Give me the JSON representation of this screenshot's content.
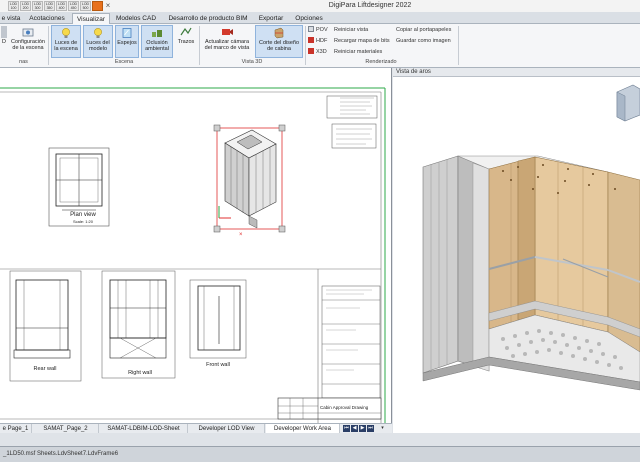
{
  "window": {
    "title": "DigiPara Liftdesigner 2022",
    "close_glyph": "×"
  },
  "qat": [
    "LOD 100",
    "LOD 200",
    "LOD 300",
    "LOD 350",
    "LOD 400",
    "LOD 450",
    "LOD 500"
  ],
  "tabs": [
    {
      "label": "e vista"
    },
    {
      "label": "Acotaciones"
    },
    {
      "label": "Visualizar"
    },
    {
      "label": "Modelos CAD"
    },
    {
      "label": "Desarrollo de producto BIM"
    },
    {
      "label": "Exportar"
    },
    {
      "label": "Opciones"
    }
  ],
  "ribbon": {
    "escenas_partial": {
      "line1": "...",
      "line2": "D"
    },
    "configuracion": {
      "line1": "Configuración",
      "line2": "de la escena"
    },
    "group_escenas": "nas",
    "escena": {
      "luces_escena": {
        "line1": "Luces de",
        "line2": "la escena"
      },
      "luces_modelo": {
        "line1": "Luces del",
        "line2": "modelo"
      },
      "espejos": {
        "line1": "Espejos"
      },
      "oclusion": {
        "line1": "Oclusión",
        "line2": "ambiental"
      },
      "trazos": {
        "line1": "Trazos"
      },
      "label": "Escena"
    },
    "vista3d": {
      "actualizar": {
        "line1": "Actualizar cámara",
        "line2": "del marco de vista"
      },
      "corte": {
        "line1": "Corte del diseño",
        "line2": "de cabina"
      },
      "label": "Vista 3D"
    },
    "renderizado": {
      "pov": "POV",
      "hdf": "HDF",
      "x3d": "X3D",
      "reiniciar_vista": "Reiniciar vista",
      "recargar_mapa": "Recargar mapa de bits",
      "reiniciar_materiales": "Reiniciar materiales",
      "copiar": "Copiar al portapapeles",
      "guardar": "Guardar como imagen",
      "label": "Renderizado"
    }
  },
  "drawing": {
    "plan_view": "Plan view",
    "plan_scale": "Scale: 1:20",
    "rear_wall": "Rear wall",
    "right_wall": "Right wall",
    "front_wall": "Front wall",
    "title_block": "Cabin Approval Drawing"
  },
  "right_pane": {
    "title": "Vista de aros"
  },
  "sheet_tabs": [
    {
      "label": "e Page_1"
    },
    {
      "label": "SAMAT_Page_2"
    },
    {
      "label": "SAMAT-LDBIM-LOD-Sheet"
    },
    {
      "label": "Developer LOD View"
    },
    {
      "label": "Developer Work Area"
    }
  ],
  "status": {
    "text": "_1LD50.msf  Sheets.LdvSheet7.LdvFrame6"
  }
}
